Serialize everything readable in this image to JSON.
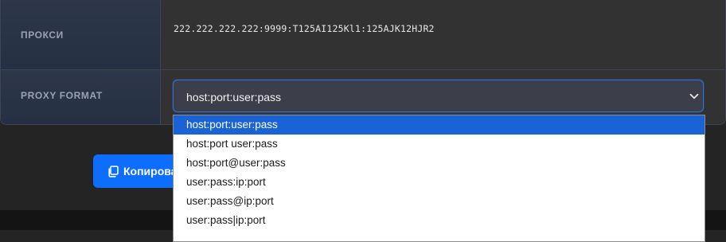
{
  "table": {
    "proxy_label": "ПРОКСИ",
    "proxy_value": "222.222.222.222:9999:T125AI125Kl1:125AJK12HJR2",
    "format_label": "PROXY FORMAT"
  },
  "format_select": {
    "value": "host:port:user:pass",
    "icon": "chevron-down-icon",
    "options": [
      {
        "label": "host:port:user:pass",
        "selected": true
      },
      {
        "label": "host:port user:pass",
        "selected": false
      },
      {
        "label": "host:port@user:pass",
        "selected": false
      },
      {
        "label": "user:pass:ip:port",
        "selected": false
      },
      {
        "label": "user:pass@ip:port",
        "selected": false
      },
      {
        "label": "user:pass|ip:port",
        "selected": false
      }
    ]
  },
  "copy_button": {
    "label": "Копировать",
    "icon": "copy-icon"
  },
  "colors": {
    "accent": "#0d6efd",
    "selection": "#1a63d6",
    "label_text": "#9aa3b3"
  }
}
